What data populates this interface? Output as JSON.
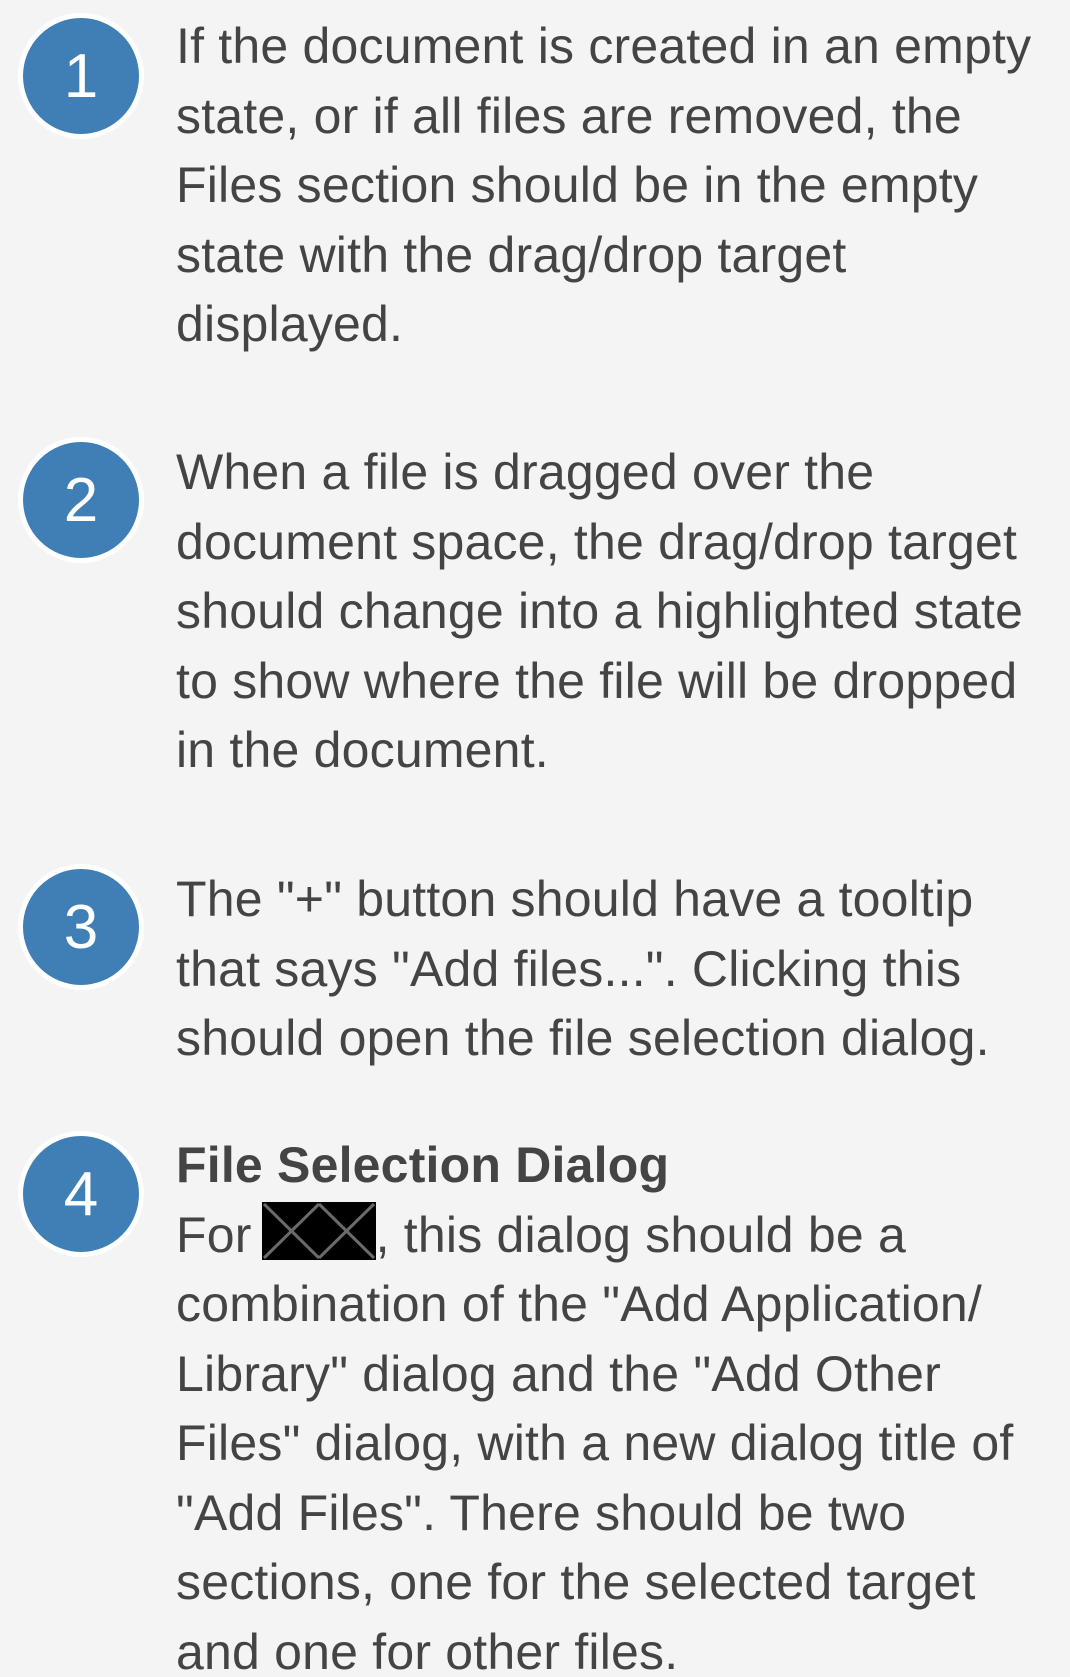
{
  "steps": [
    {
      "number": "1",
      "text": "If the document is created in an empty state, or if all files are removed, the Files section should be in the empty state with the drag/drop target displayed."
    },
    {
      "number": "2",
      "text": "When a file is dragged over the document space, the drag/drop target should change into a highlighted state to show where the file will be dropped in the document."
    },
    {
      "number": "3",
      "text": "The \"+\" button should have a tooltip that says \"Add files...\". Clicking this should open the file selection dialog."
    },
    {
      "number": "4",
      "heading": "File Selection Dialog",
      "text_before": "For",
      "text_after": ", this dialog should be a combination of the \"Add Application/ Library\" dialog and the \"Add Other Files\" dialog, with a new dialog title of \"Add Files\". There should be two sections, one for the selected target and one for other files."
    }
  ],
  "colors": {
    "badge": "#3f7fb5",
    "background": "#f4f4f4",
    "text": "#444444"
  }
}
